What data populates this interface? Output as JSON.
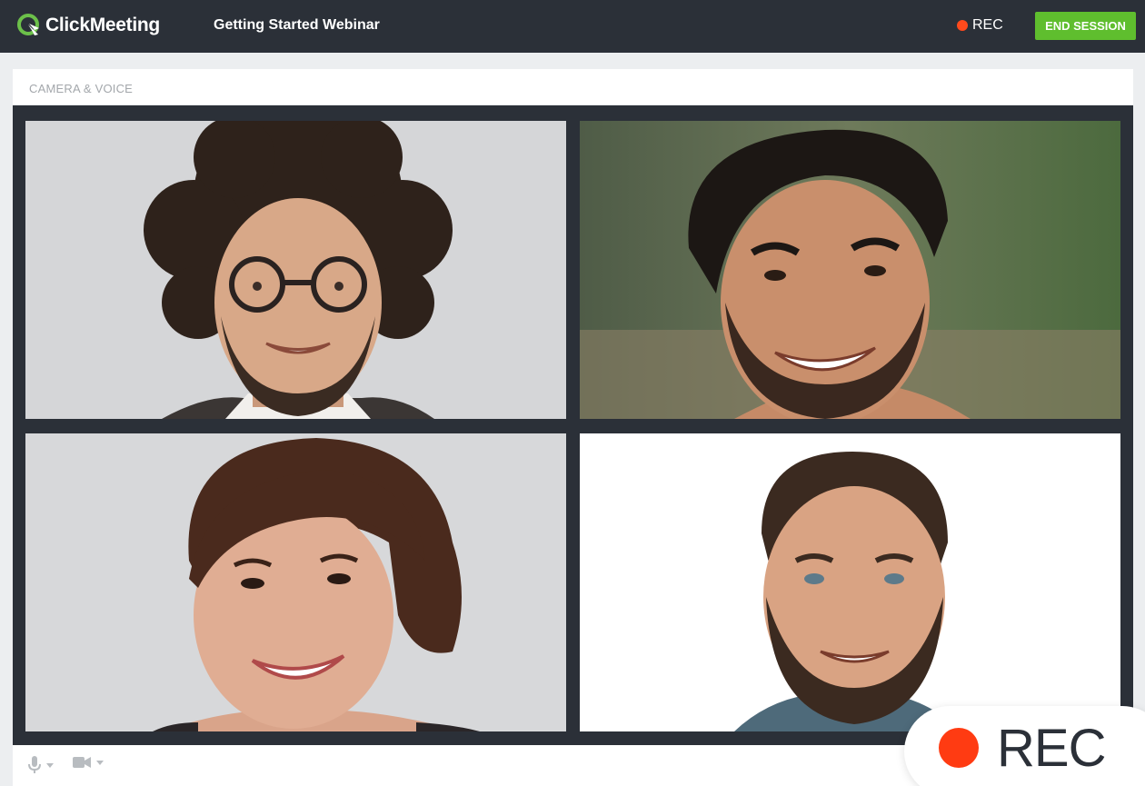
{
  "header": {
    "brand": "ClickMeeting",
    "session_title": "Getting Started Webinar",
    "rec_label": "REC",
    "end_session_label": "END SESSION"
  },
  "panel": {
    "title": "CAMERA & VOICE"
  },
  "participants": [
    {
      "icon": "participant-video-curly-hair-glasses"
    },
    {
      "icon": "participant-video-dark-hair-beard"
    },
    {
      "icon": "participant-video-woman-short-hair"
    },
    {
      "icon": "participant-video-bearded-man-white-background"
    }
  ],
  "controls": {
    "mic_icon": "microphone-icon",
    "camera_icon": "camera-icon"
  },
  "recording_badge": {
    "label": "REC"
  },
  "colors": {
    "topbar": "#2b3038",
    "accent_green": "#5fbe2e",
    "rec_red": "#ff4a1c"
  }
}
